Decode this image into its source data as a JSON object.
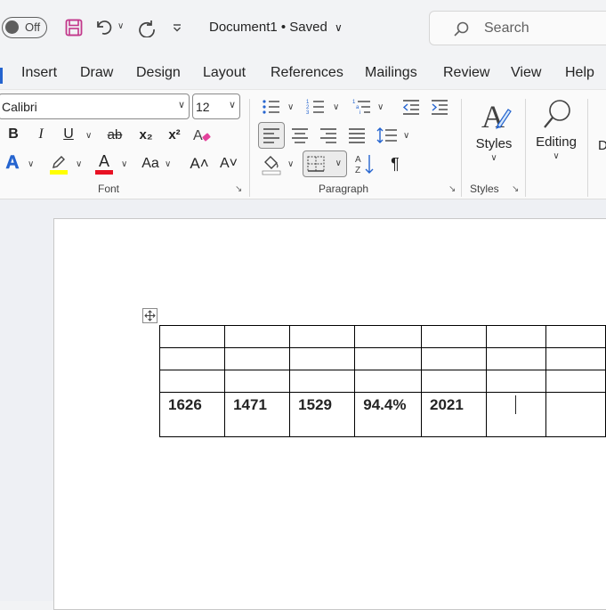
{
  "titlebar": {
    "autosave_label": "Off",
    "doc_title": "Document1 • Saved",
    "search_placeholder": "Search"
  },
  "tabs": [
    "Insert",
    "Draw",
    "Design",
    "Layout",
    "References",
    "Mailings",
    "Review",
    "View",
    "Help"
  ],
  "ribbon": {
    "font_name": "Calibri",
    "font_size": "12",
    "groups": {
      "font": "Font",
      "paragraph": "Paragraph",
      "styles": "Styles"
    },
    "styles_button": "Styles",
    "editing_button": "Editing",
    "bold": "B",
    "italic": "I",
    "underline": "U",
    "strike": "ab",
    "sub": "x₂",
    "sup": "x²",
    "change_case": "Aa",
    "grow": "A˄",
    "shrink": "A˅",
    "font_color": "A",
    "text_effects": "A",
    "pilcrow": "¶",
    "truncated_label": "D"
  },
  "table": {
    "rows": [
      [
        "",
        "",
        "",
        "",
        "",
        "",
        ""
      ],
      [
        "",
        "",
        "",
        "",
        "",
        "",
        ""
      ],
      [
        "",
        "",
        "",
        "",
        "",
        "",
        ""
      ],
      [
        "1626",
        "1471",
        "1529",
        "94.4%",
        "2021",
        "",
        ""
      ]
    ]
  },
  "colors": {
    "save_icon": "#c2378b",
    "highlight": "#ffff00",
    "font_color": "#e81123",
    "text_effect": "#2564cf"
  }
}
